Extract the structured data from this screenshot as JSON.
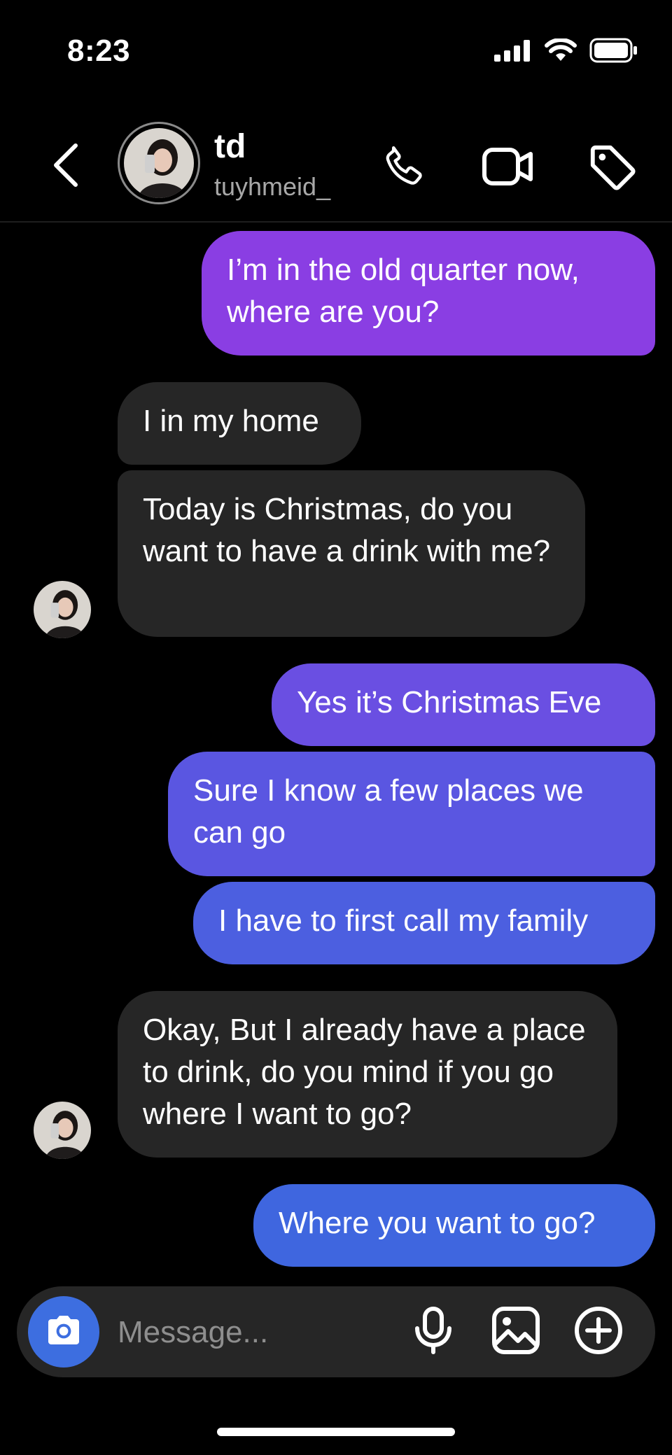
{
  "status_bar": {
    "time": "8:23",
    "icons": [
      "signal-icon",
      "wifi-icon",
      "battery-icon"
    ]
  },
  "header": {
    "back_icon": "chevron-left-icon",
    "contact_name": "td",
    "contact_username": "tuyhmeid_",
    "actions": [
      "phone-icon",
      "video-camera-icon",
      "tag-icon"
    ]
  },
  "messages": [
    {
      "direction": "outgoing",
      "text": "I’m in the old quarter now, where are you?",
      "color": "#8a3ee3"
    },
    {
      "direction": "incoming",
      "text": "I in my home"
    },
    {
      "direction": "incoming",
      "text": "Today is Christmas, do you want to have a drink with me?"
    },
    {
      "direction": "outgoing",
      "text": "Yes it’s Christmas Eve",
      "color": "#6a4fe2"
    },
    {
      "direction": "outgoing",
      "text": "Sure I know a few places we can go",
      "color": "#5a56e1"
    },
    {
      "direction": "outgoing",
      "text": "I have to first call my family",
      "color": "#4c5fe0"
    },
    {
      "direction": "incoming",
      "text": "Okay, But I already have a place to drink, do you mind if you go where I want to go?"
    },
    {
      "direction": "outgoing",
      "text": "Where you want to go?",
      "color": "#3f66df"
    }
  ],
  "composer": {
    "placeholder": "Message...",
    "camera_icon": "camera-icon",
    "icons": [
      "microphone-icon",
      "image-icon",
      "plus-circle-icon"
    ],
    "camera_color": "#3d6ee0"
  },
  "colors": {
    "background": "#000000",
    "incoming_bubble": "#262626"
  }
}
